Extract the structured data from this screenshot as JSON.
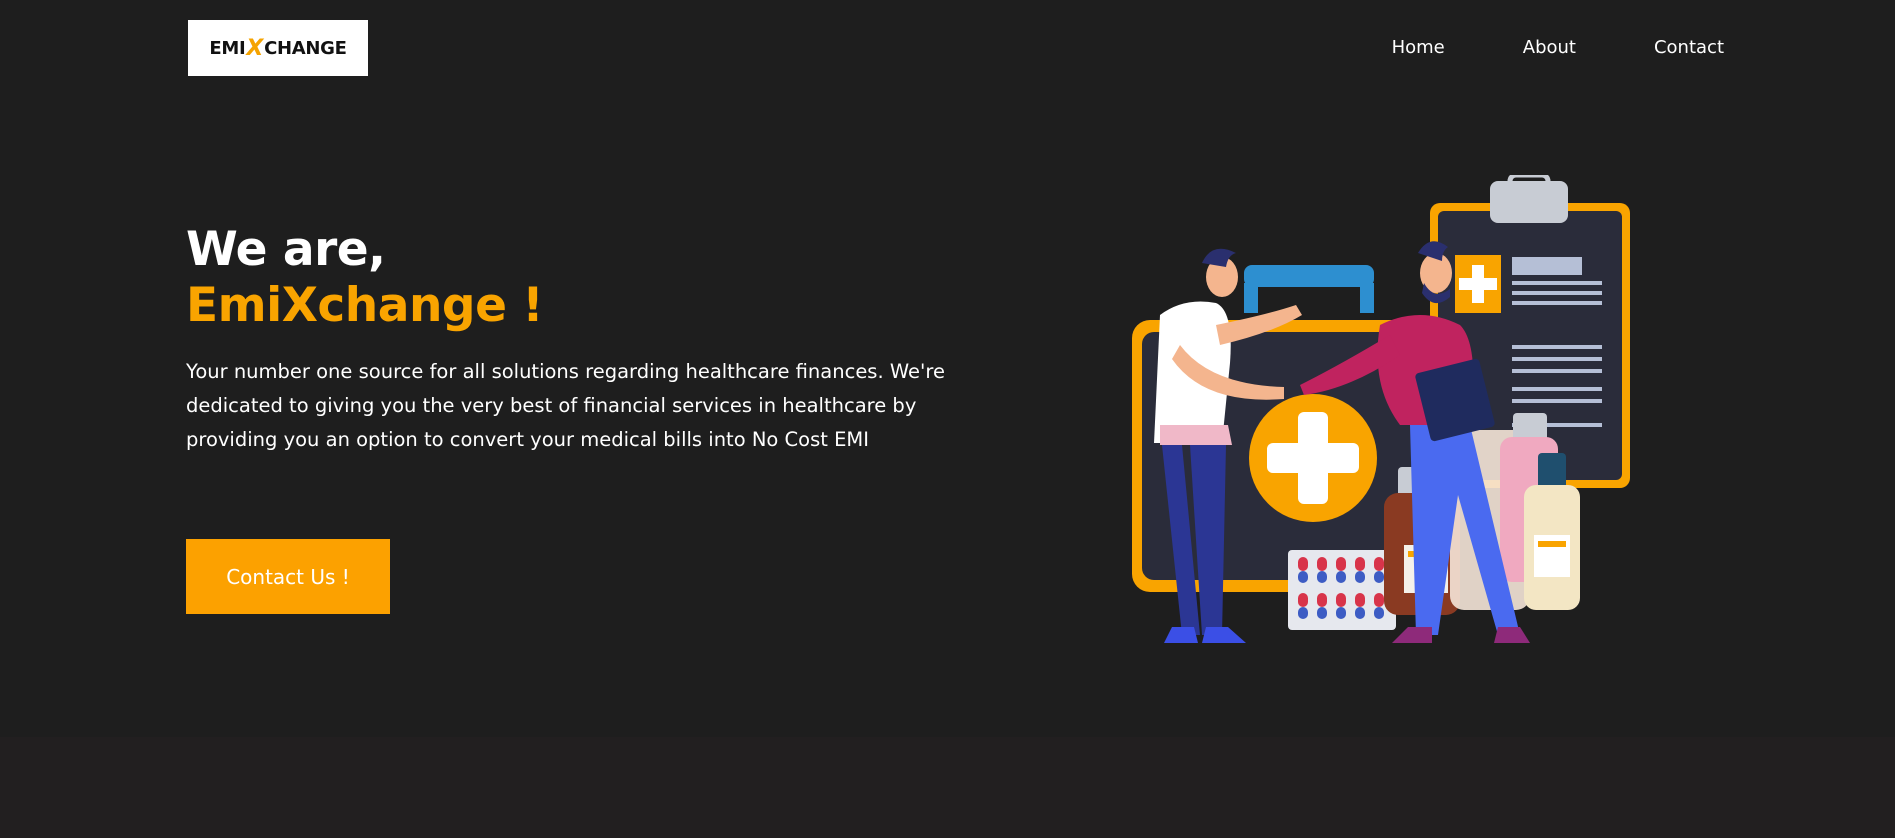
{
  "header": {
    "logo": {
      "prefix": "EMI",
      "x": "X",
      "suffix": "CHANGE"
    },
    "nav": [
      "Home",
      "About",
      "Contact"
    ]
  },
  "hero": {
    "heading_line1": "We are,",
    "heading_line2": "EmiXchange !",
    "description": "Your number one source for all solutions regarding healthcare finances. We're dedicated to giving you the very best of financial services in healthcare by providing you an option to convert your medical bills into No Cost EMI",
    "cta_label": "Contact Us !"
  },
  "colors": {
    "background": "#1e1e1e",
    "accent": "#f9a400",
    "text": "#ffffff"
  }
}
